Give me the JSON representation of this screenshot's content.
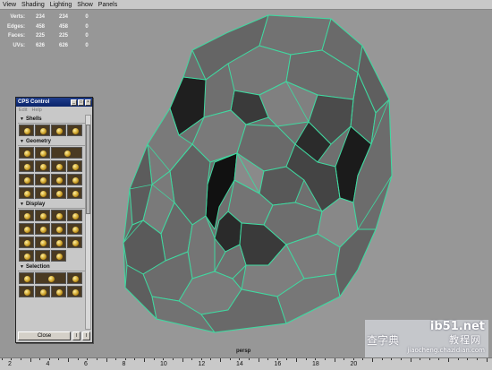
{
  "menu": [
    "View",
    "Shading",
    "Lighting",
    "Show",
    "Panels"
  ],
  "hud": [
    {
      "label": "Verts:",
      "values": [
        "234",
        "234",
        "0"
      ]
    },
    {
      "label": "Edges:",
      "values": [
        "458",
        "458",
        "0"
      ]
    },
    {
      "label": "Faces:",
      "values": [
        "225",
        "225",
        "0"
      ]
    },
    {
      "label": "UVs:",
      "values": [
        "626",
        "626",
        "0"
      ]
    }
  ],
  "camera_label": "persp",
  "panel": {
    "title": "CPS Control",
    "menu": [
      "Edit",
      "Help"
    ],
    "sections": [
      "Shells",
      "Geometry",
      "Display",
      "Selection"
    ],
    "close_label": "Close",
    "btn_a": "I",
    "btn_b": "I"
  },
  "timeline": {
    "ticks": [
      "2",
      "4",
      "6",
      "8",
      "10",
      "12",
      "14",
      "16",
      "18",
      "20"
    ]
  },
  "watermark": {
    "line1": "ib51.net",
    "line2": "教程网",
    "line3": "查字典",
    "line4": "jiaocheng.chazidian.com"
  },
  "colors": {
    "wire": "#40d8a0",
    "face": "#6e6e6e",
    "bg": "#979797"
  }
}
